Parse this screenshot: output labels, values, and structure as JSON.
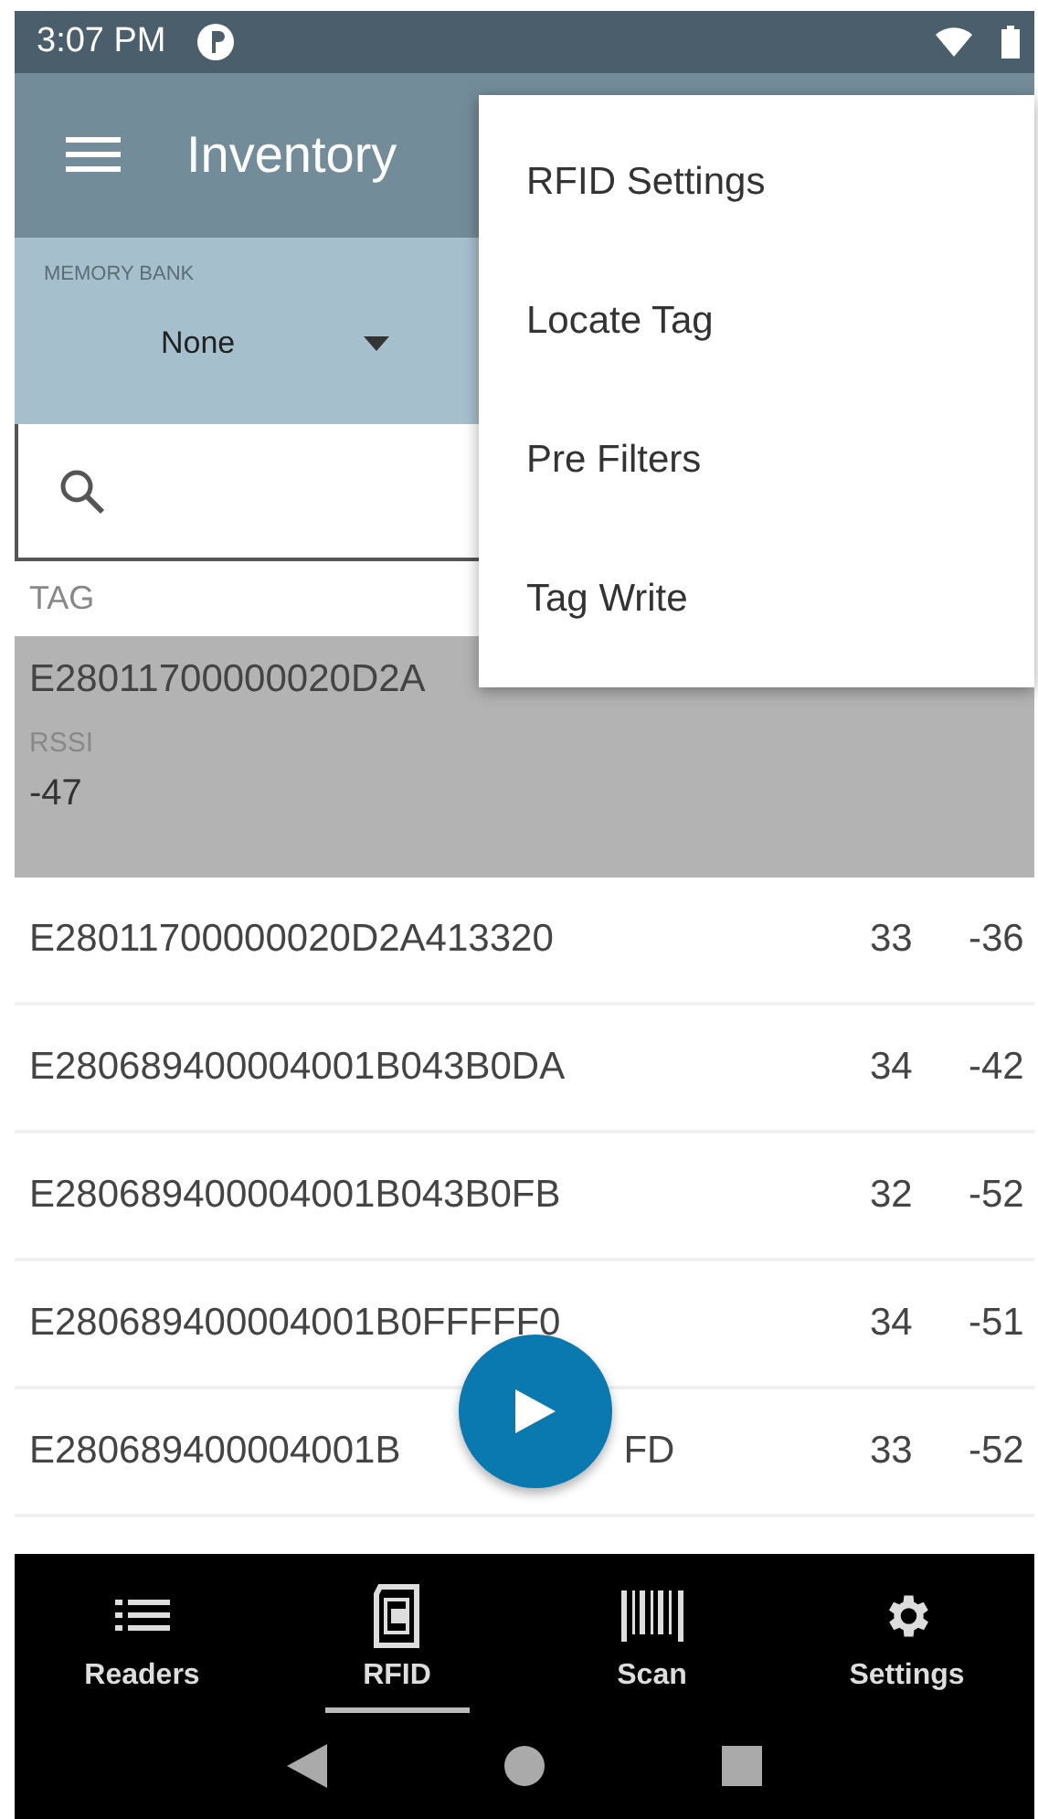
{
  "status_bar": {
    "time": "3:07 PM"
  },
  "toolbar": {
    "title": "Inventory"
  },
  "memory_bank": {
    "label": "MEMORY BANK",
    "value": "None"
  },
  "table": {
    "columns": [
      "TAG"
    ],
    "rows": [
      {
        "tag": "E28011700000020D2A",
        "selected": true,
        "detail_label": "RSSI",
        "detail_value": "-47"
      },
      {
        "tag": "E28011700000020D2A413320",
        "count": "33",
        "rssi": "-36",
        "selected": false
      },
      {
        "tag": "E280689400004001B043B0DA",
        "count": "34",
        "rssi": "-42",
        "selected": false
      },
      {
        "tag": "E280689400004001B043B0FB",
        "count": "32",
        "rssi": "-52",
        "selected": false
      },
      {
        "tag": "E280689400004001B0FFFFF0",
        "count": "34",
        "rssi": "-51",
        "selected": false
      },
      {
        "tag": "E280689400004001B",
        "tag_end": "FD",
        "count": "33",
        "rssi": "-52",
        "selected": false
      }
    ]
  },
  "menu": [
    "RFID Settings",
    "Locate Tag",
    "Pre Filters",
    "Tag Write"
  ],
  "bottom_nav": [
    {
      "kind": "list",
      "label": "Readers",
      "selected": false
    },
    {
      "kind": "rfid",
      "label": "RFID",
      "selected": true
    },
    {
      "kind": "barcode",
      "label": "Scan",
      "selected": false
    },
    {
      "kind": "gear",
      "label": "Settings",
      "selected": false
    }
  ]
}
